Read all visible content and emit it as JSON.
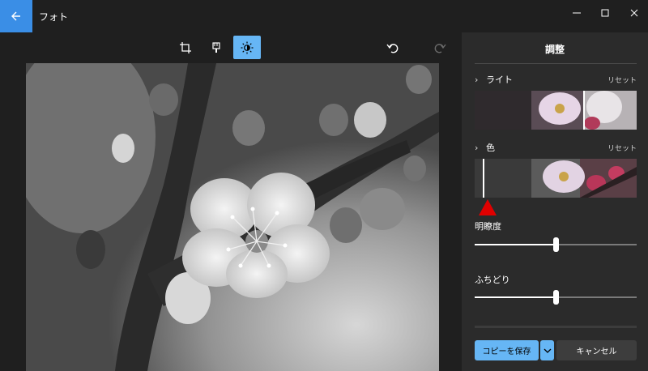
{
  "window": {
    "title": "フォト",
    "controls": [
      "minimize-icon",
      "maximize-icon",
      "close-icon"
    ]
  },
  "toolbar": {
    "tools": [
      {
        "name": "crop-icon"
      },
      {
        "name": "filter-icon"
      },
      {
        "name": "adjust-brightness-icon",
        "active": true
      }
    ],
    "undo": "undo-icon",
    "redo": "redo-icon"
  },
  "panel": {
    "title": "調整",
    "light": {
      "label": "ライト",
      "reset": "リセット"
    },
    "color": {
      "label": "色",
      "reset": "リセット"
    },
    "clarity": {
      "label": "明瞭度",
      "value": 0.5
    },
    "vignette": {
      "label": "ふちどり",
      "value": 0.5
    },
    "save_label": "コピーを保存",
    "cancel_label": "キャンセル"
  },
  "colors": {
    "accent": "#66b6f5",
    "back_button": "#3a8ee6",
    "annotation_arrow": "#e00000"
  }
}
